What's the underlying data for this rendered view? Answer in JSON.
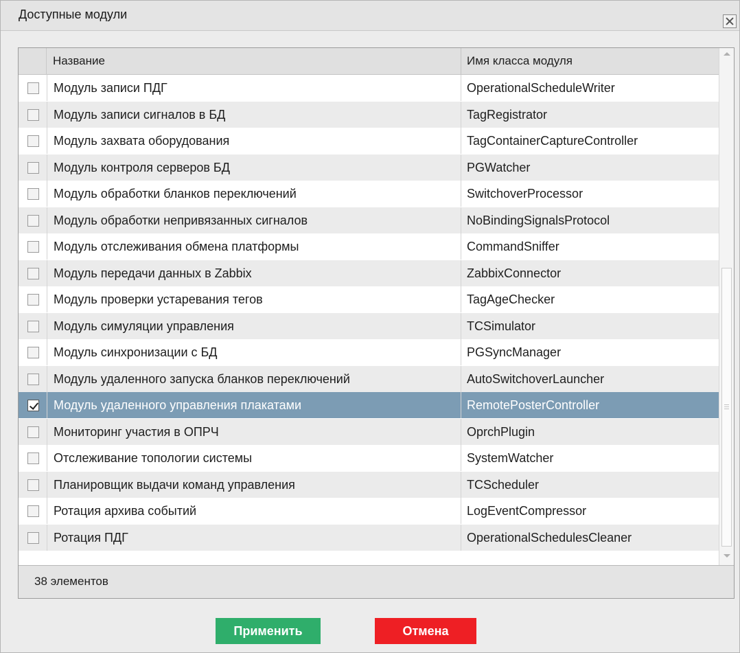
{
  "dialog": {
    "title": "Доступные модули"
  },
  "table": {
    "columns": {
      "name": "Название",
      "class": "Имя класса модуля"
    },
    "rows": [
      {
        "name": "Модуль записи ПДГ",
        "class": "OperationalScheduleWriter",
        "checked": false,
        "selected": false
      },
      {
        "name": "Модуль записи сигналов в БД",
        "class": "TagRegistrator",
        "checked": false,
        "selected": false
      },
      {
        "name": "Модуль захвата оборудования",
        "class": "TagContainerCaptureController",
        "checked": false,
        "selected": false
      },
      {
        "name": "Модуль контроля серверов БД",
        "class": "PGWatcher",
        "checked": false,
        "selected": false
      },
      {
        "name": "Модуль обработки бланков переключений",
        "class": "SwitchoverProcessor",
        "checked": false,
        "selected": false
      },
      {
        "name": "Модуль обработки непривязанных сигналов",
        "class": "NoBindingSignalsProtocol",
        "checked": false,
        "selected": false
      },
      {
        "name": "Модуль отслеживания обмена платформы",
        "class": "CommandSniffer",
        "checked": false,
        "selected": false
      },
      {
        "name": "Модуль передачи данных в Zabbix",
        "class": "ZabbixConnector",
        "checked": false,
        "selected": false
      },
      {
        "name": "Модуль проверки устаревания тегов",
        "class": "TagAgeChecker",
        "checked": false,
        "selected": false
      },
      {
        "name": "Модуль симуляции управления",
        "class": "TCSimulator",
        "checked": false,
        "selected": false
      },
      {
        "name": "Модуль синхронизации с БД",
        "class": "PGSyncManager",
        "checked": false,
        "selected": false
      },
      {
        "name": "Модуль удаленного запуска бланков переключений",
        "class": "AutoSwitchoverLauncher",
        "checked": false,
        "selected": false
      },
      {
        "name": "Модуль удаленного управления плакатами",
        "class": "RemotePosterController",
        "checked": true,
        "selected": true
      },
      {
        "name": "Мониторинг участия в ОПРЧ",
        "class": "OprchPlugin",
        "checked": false,
        "selected": false
      },
      {
        "name": "Отслеживание топологии системы",
        "class": "SystemWatcher",
        "checked": false,
        "selected": false
      },
      {
        "name": "Планировщик выдачи команд управления",
        "class": "TCScheduler",
        "checked": false,
        "selected": false
      },
      {
        "name": "Ротация архива событий",
        "class": "LogEventCompressor",
        "checked": false,
        "selected": false
      },
      {
        "name": "Ротация ПДГ",
        "class": "OperationalSchedulesCleaner",
        "checked": false,
        "selected": false
      }
    ],
    "footer_count": "38 элементов"
  },
  "buttons": {
    "apply": "Применить",
    "cancel": "Отмена"
  },
  "colors": {
    "apply": "#2fae6b",
    "cancel": "#ee1f24",
    "selected_row": "#7c9cb4"
  }
}
